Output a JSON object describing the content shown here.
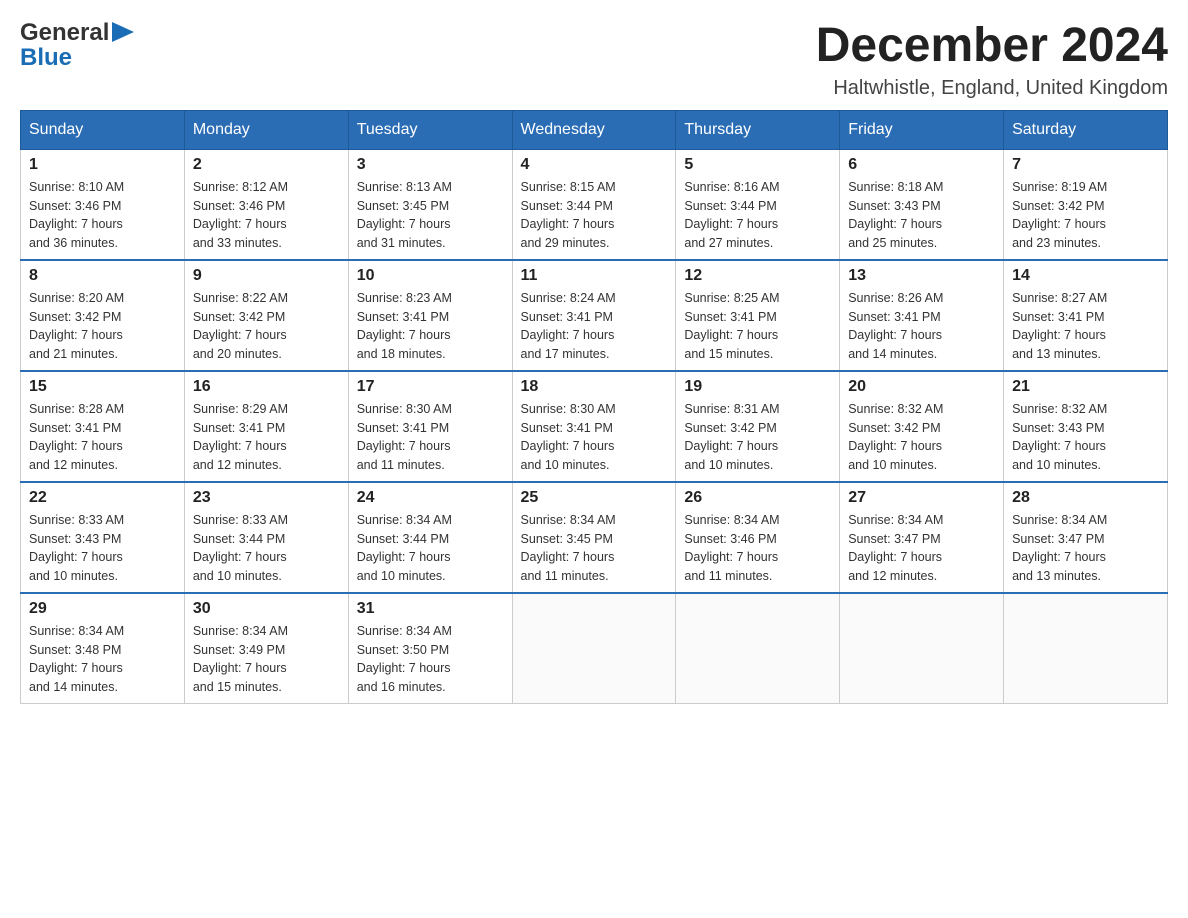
{
  "header": {
    "logo_text_general": "General",
    "logo_text_blue": "Blue",
    "month_title": "December 2024",
    "location": "Haltwhistle, England, United Kingdom"
  },
  "days_of_week": [
    "Sunday",
    "Monday",
    "Tuesday",
    "Wednesday",
    "Thursday",
    "Friday",
    "Saturday"
  ],
  "weeks": [
    [
      {
        "day": "1",
        "sunrise": "8:10 AM",
        "sunset": "3:46 PM",
        "daylight": "7 hours and 36 minutes."
      },
      {
        "day": "2",
        "sunrise": "8:12 AM",
        "sunset": "3:46 PM",
        "daylight": "7 hours and 33 minutes."
      },
      {
        "day": "3",
        "sunrise": "8:13 AM",
        "sunset": "3:45 PM",
        "daylight": "7 hours and 31 minutes."
      },
      {
        "day": "4",
        "sunrise": "8:15 AM",
        "sunset": "3:44 PM",
        "daylight": "7 hours and 29 minutes."
      },
      {
        "day": "5",
        "sunrise": "8:16 AM",
        "sunset": "3:44 PM",
        "daylight": "7 hours and 27 minutes."
      },
      {
        "day": "6",
        "sunrise": "8:18 AM",
        "sunset": "3:43 PM",
        "daylight": "7 hours and 25 minutes."
      },
      {
        "day": "7",
        "sunrise": "8:19 AM",
        "sunset": "3:42 PM",
        "daylight": "7 hours and 23 minutes."
      }
    ],
    [
      {
        "day": "8",
        "sunrise": "8:20 AM",
        "sunset": "3:42 PM",
        "daylight": "7 hours and 21 minutes."
      },
      {
        "day": "9",
        "sunrise": "8:22 AM",
        "sunset": "3:42 PM",
        "daylight": "7 hours and 20 minutes."
      },
      {
        "day": "10",
        "sunrise": "8:23 AM",
        "sunset": "3:41 PM",
        "daylight": "7 hours and 18 minutes."
      },
      {
        "day": "11",
        "sunrise": "8:24 AM",
        "sunset": "3:41 PM",
        "daylight": "7 hours and 17 minutes."
      },
      {
        "day": "12",
        "sunrise": "8:25 AM",
        "sunset": "3:41 PM",
        "daylight": "7 hours and 15 minutes."
      },
      {
        "day": "13",
        "sunrise": "8:26 AM",
        "sunset": "3:41 PM",
        "daylight": "7 hours and 14 minutes."
      },
      {
        "day": "14",
        "sunrise": "8:27 AM",
        "sunset": "3:41 PM",
        "daylight": "7 hours and 13 minutes."
      }
    ],
    [
      {
        "day": "15",
        "sunrise": "8:28 AM",
        "sunset": "3:41 PM",
        "daylight": "7 hours and 12 minutes."
      },
      {
        "day": "16",
        "sunrise": "8:29 AM",
        "sunset": "3:41 PM",
        "daylight": "7 hours and 12 minutes."
      },
      {
        "day": "17",
        "sunrise": "8:30 AM",
        "sunset": "3:41 PM",
        "daylight": "7 hours and 11 minutes."
      },
      {
        "day": "18",
        "sunrise": "8:30 AM",
        "sunset": "3:41 PM",
        "daylight": "7 hours and 10 minutes."
      },
      {
        "day": "19",
        "sunrise": "8:31 AM",
        "sunset": "3:42 PM",
        "daylight": "7 hours and 10 minutes."
      },
      {
        "day": "20",
        "sunrise": "8:32 AM",
        "sunset": "3:42 PM",
        "daylight": "7 hours and 10 minutes."
      },
      {
        "day": "21",
        "sunrise": "8:32 AM",
        "sunset": "3:43 PM",
        "daylight": "7 hours and 10 minutes."
      }
    ],
    [
      {
        "day": "22",
        "sunrise": "8:33 AM",
        "sunset": "3:43 PM",
        "daylight": "7 hours and 10 minutes."
      },
      {
        "day": "23",
        "sunrise": "8:33 AM",
        "sunset": "3:44 PM",
        "daylight": "7 hours and 10 minutes."
      },
      {
        "day": "24",
        "sunrise": "8:34 AM",
        "sunset": "3:44 PM",
        "daylight": "7 hours and 10 minutes."
      },
      {
        "day": "25",
        "sunrise": "8:34 AM",
        "sunset": "3:45 PM",
        "daylight": "7 hours and 11 minutes."
      },
      {
        "day": "26",
        "sunrise": "8:34 AM",
        "sunset": "3:46 PM",
        "daylight": "7 hours and 11 minutes."
      },
      {
        "day": "27",
        "sunrise": "8:34 AM",
        "sunset": "3:47 PM",
        "daylight": "7 hours and 12 minutes."
      },
      {
        "day": "28",
        "sunrise": "8:34 AM",
        "sunset": "3:47 PM",
        "daylight": "7 hours and 13 minutes."
      }
    ],
    [
      {
        "day": "29",
        "sunrise": "8:34 AM",
        "sunset": "3:48 PM",
        "daylight": "7 hours and 14 minutes."
      },
      {
        "day": "30",
        "sunrise": "8:34 AM",
        "sunset": "3:49 PM",
        "daylight": "7 hours and 15 minutes."
      },
      {
        "day": "31",
        "sunrise": "8:34 AM",
        "sunset": "3:50 PM",
        "daylight": "7 hours and 16 minutes."
      },
      null,
      null,
      null,
      null
    ]
  ],
  "labels": {
    "sunrise": "Sunrise:",
    "sunset": "Sunset:",
    "daylight": "Daylight:"
  }
}
